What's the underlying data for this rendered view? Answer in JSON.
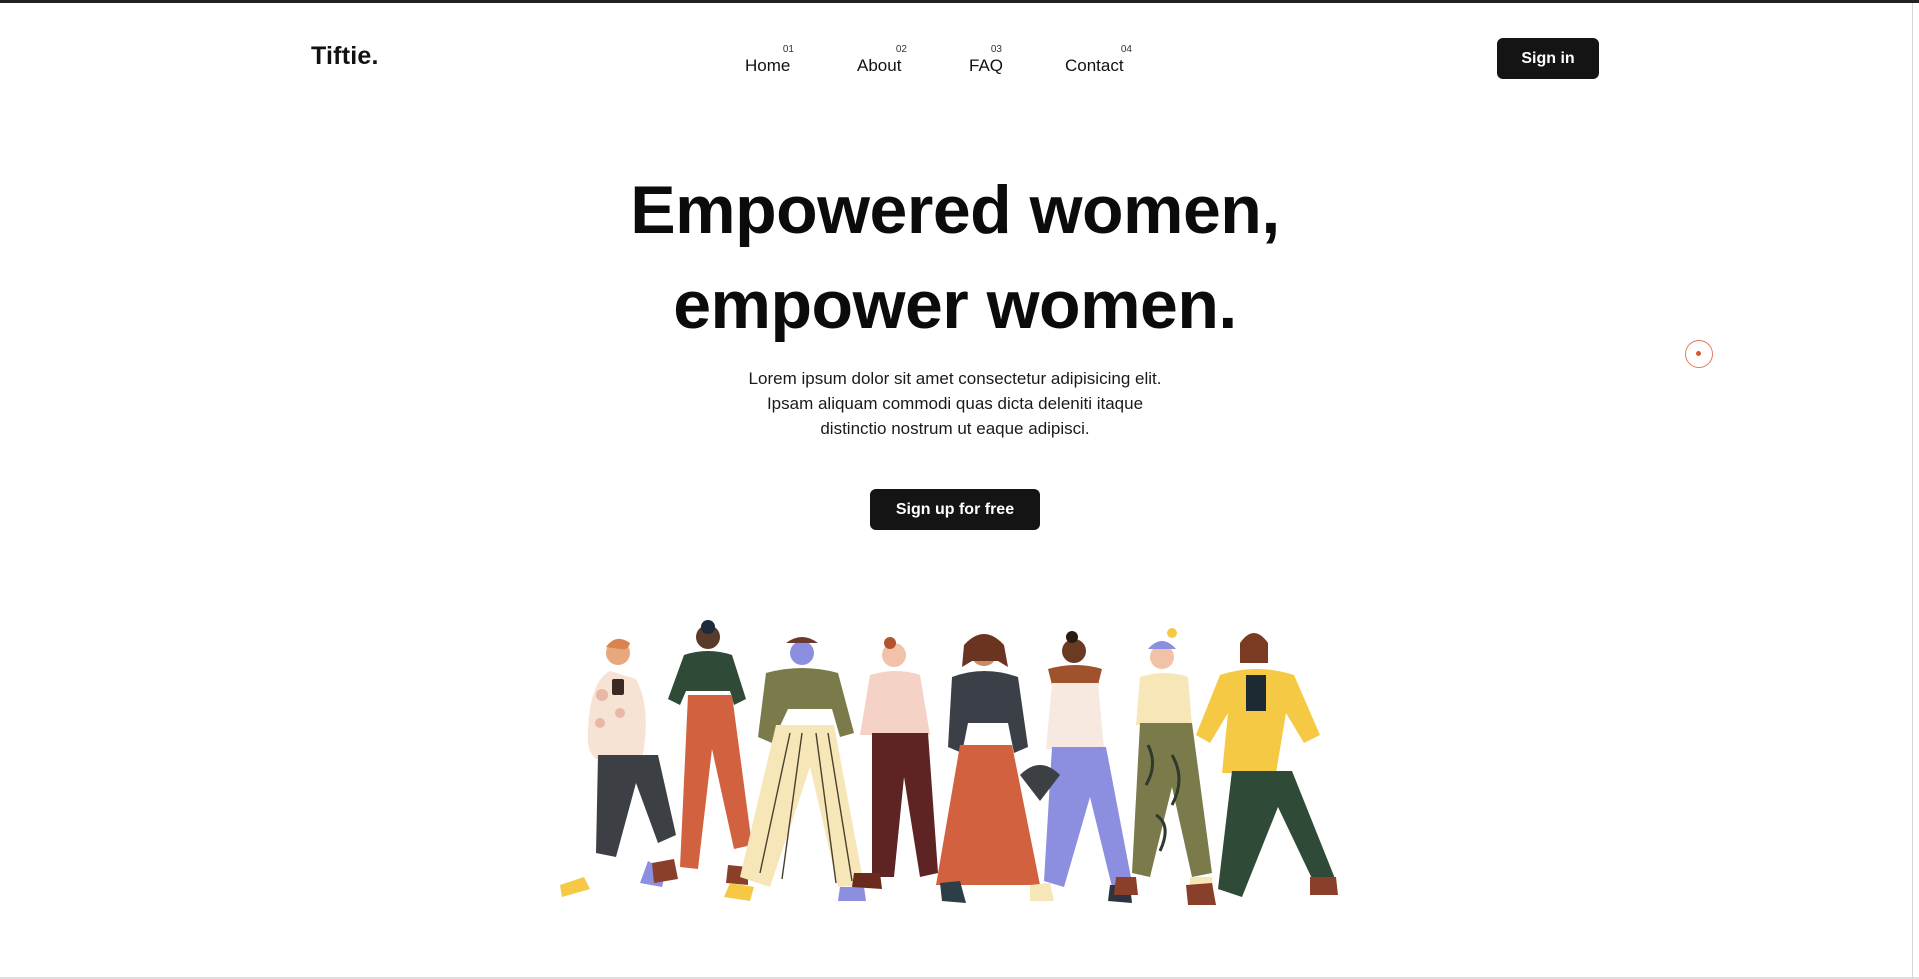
{
  "brand": {
    "logo": "Tiftie."
  },
  "nav": {
    "items": [
      {
        "num": "01",
        "label": "Home"
      },
      {
        "num": "02",
        "label": "About"
      },
      {
        "num": "03",
        "label": "FAQ"
      },
      {
        "num": "04",
        "label": "Contact"
      }
    ]
  },
  "header": {
    "signin_label": "Sign in"
  },
  "hero": {
    "title_line1": "Empowered women,",
    "title_line2": "empower women.",
    "text_line1": "Lorem ipsum dolor sit amet consectetur adipisicing elit.",
    "text_line2": "Ipsam aliquam commodi quas dicta deleniti itaque",
    "text_line3": "distinctio nostrum ut eaque adipisci.",
    "cta_label": "Sign up for free"
  },
  "illustration": {
    "icon": "group-of-women-walking-illustration"
  },
  "colors": {
    "button_bg": "#141414",
    "text": "#0b0b0b",
    "accent_cursor": "#d9552c",
    "yellow": "#f6c945",
    "green": "#2f4a37",
    "orange": "#d2623f",
    "lavender": "#8c8ee0",
    "cream": "#f7e6b8",
    "olive": "#7b7a4a"
  }
}
